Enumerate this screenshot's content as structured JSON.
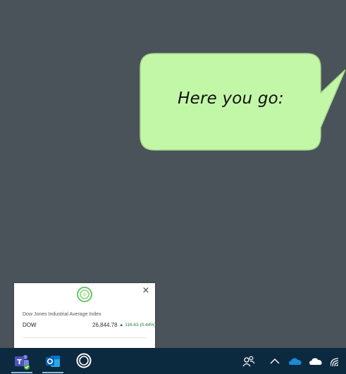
{
  "bubble": {
    "text": "Here you go:",
    "fill_color": "#c3f7a8",
    "stroke_color": "#a6d68c"
  },
  "stock_popup": {
    "index_name": "Dow Jones Industrial Average Index",
    "symbol": "DOW",
    "price": "26,844.78",
    "change": "▲ 116.63 (0.44%)",
    "change_color": "#1e7d3a",
    "close_label": "×",
    "logo_icon": "circle-logo-icon"
  },
  "taskbar": {
    "background": "#0c2a3f",
    "apps": [
      {
        "name": "Microsoft Teams",
        "icon": "teams-icon"
      },
      {
        "name": "Outlook",
        "icon": "outlook-icon"
      },
      {
        "name": "Cortana",
        "icon": "cortana-icon"
      }
    ],
    "tray": [
      {
        "name": "People",
        "icon": "people-icon"
      },
      {
        "name": "Show hidden icons",
        "icon": "chevron-up-icon"
      },
      {
        "name": "OneDrive",
        "icon": "onedrive-icon"
      },
      {
        "name": "OneDrive Personal",
        "icon": "cloud-icon"
      },
      {
        "name": "Network",
        "icon": "wifi-icon"
      }
    ]
  }
}
